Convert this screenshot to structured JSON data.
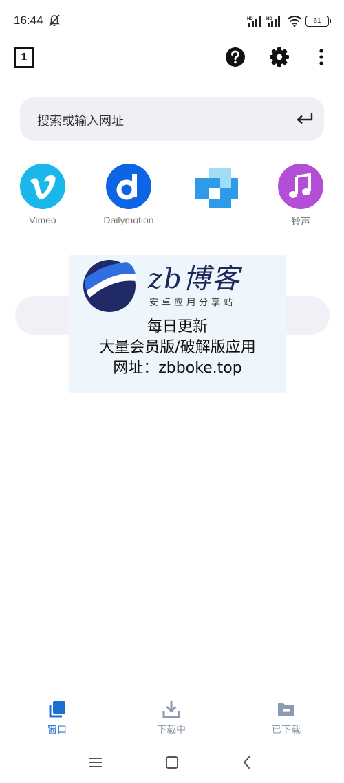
{
  "status_bar": {
    "time": "16:44",
    "battery": "61",
    "icons": [
      "mute-icon",
      "signal-icon",
      "signal-icon",
      "wifi-icon",
      "battery-icon"
    ]
  },
  "toolbar": {
    "tab_count": "1",
    "icons": [
      "help-icon",
      "gear-icon",
      "more-vert-icon"
    ]
  },
  "search": {
    "placeholder": "搜索或输入网址",
    "icon": "enter-icon"
  },
  "shortcuts": [
    {
      "label": "Vimeo",
      "color": "#1ab7ea",
      "icon": "vimeo-icon"
    },
    {
      "label": "Dailymotion",
      "color": "#0d65e6",
      "icon": "dailymotion-icon"
    },
    {
      "label": "",
      "color": "#2f9be8",
      "icon": "blocks-icon"
    },
    {
      "label": "铃声",
      "color": "#b24fd6",
      "icon": "music-note-icon"
    }
  ],
  "watermark": {
    "brand": "zb博客",
    "subtitle": "安卓应用分享站",
    "line1": "每日更新",
    "line2": "大量会员版/破解版应用",
    "line3": "网址：zbboke.top"
  },
  "bottom_nav": {
    "active_color": "#1f6fd1",
    "inactive_color": "#8a9ab0",
    "items": [
      {
        "label": "窗口",
        "icon": "windows-icon",
        "active": true
      },
      {
        "label": "下载中",
        "icon": "download-icon",
        "active": false
      },
      {
        "label": "已下载",
        "icon": "folder-icon",
        "active": false
      }
    ]
  },
  "system_nav": {
    "icons": [
      "menu-icon",
      "home-icon",
      "back-icon"
    ]
  }
}
